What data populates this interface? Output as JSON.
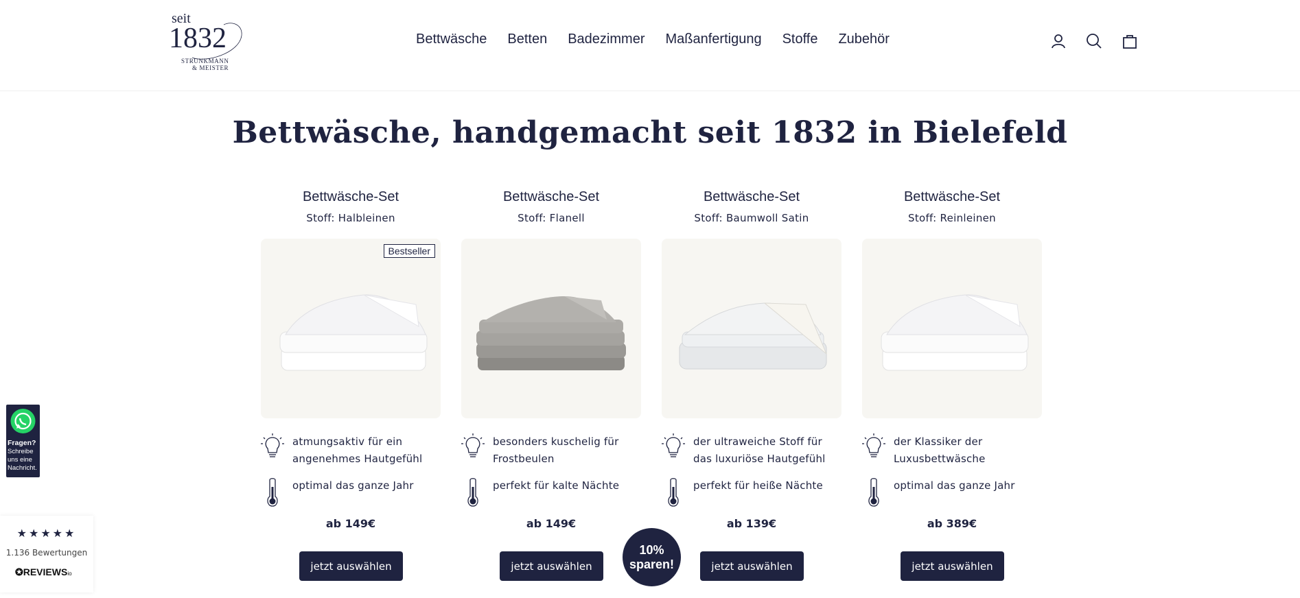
{
  "logo": {
    "seit": "seit",
    "year": "1832",
    "line1": "STRUNKMANN",
    "line2": "& MEISTER"
  },
  "nav": {
    "items": [
      "Bettwäsche",
      "Betten",
      "Badezimmer",
      "Maßanfertigung",
      "Stoffe",
      "Zubehör"
    ]
  },
  "header_icons": [
    "account-icon",
    "search-icon",
    "cart-icon"
  ],
  "page_title": "Bettwäsche, handgemacht seit 1832 in Bielefeld",
  "products": [
    {
      "title": "Bettwäsche-Set",
      "fabric": "Stoff: Halbleinen",
      "badge": "Bestseller",
      "feature1": "atmungsaktiv für ein angenehmes Hautgefühl",
      "feature2": "optimal das ganze Jahr",
      "price": "ab 149€",
      "button": "jetzt auswählen",
      "image": "white-folded-linen"
    },
    {
      "title": "Bettwäsche-Set",
      "fabric": "Stoff: Flanell",
      "badge": "",
      "feature1": "besonders kuschelig für Frostbeulen",
      "feature2": "perfekt für kalte Nächte",
      "price": "ab 149€",
      "button": "jetzt auswählen",
      "image": "grey-folded-flannel"
    },
    {
      "title": "Bettwäsche-Set",
      "fabric": "Stoff: Baumwoll Satin",
      "badge": "",
      "feature1": "der ultraweiche Stoff für das luxuriöse Hautgefühl",
      "feature2": "perfekt für heiße Nächte",
      "price": "ab 139€",
      "button": "jetzt auswählen",
      "image": "white-folded-satin"
    },
    {
      "title": "Bettwäsche-Set",
      "fabric": "Stoff: Reinleinen",
      "badge": "",
      "feature1": "der Klassiker der Luxusbettwäsche",
      "feature2": "optimal das ganze Jahr",
      "price": "ab 389€",
      "button": "jetzt auswählen",
      "image": "white-folded-linen"
    }
  ],
  "whatsapp": {
    "line1": "Fragen?",
    "line2": "Schreibe",
    "line3": "uns eine",
    "line4": "Nachricht."
  },
  "reviews": {
    "stars": "★★★★★",
    "count": "1.136 Bewertungen",
    "brand": "REVIEWS",
    "brand_suffix": "io"
  },
  "promo": {
    "line1": "10%",
    "line2": "sparen!"
  },
  "colors": {
    "brand": "#1f2340",
    "card_bg": "#f7f6f2",
    "whatsapp_green": "#25d366"
  }
}
